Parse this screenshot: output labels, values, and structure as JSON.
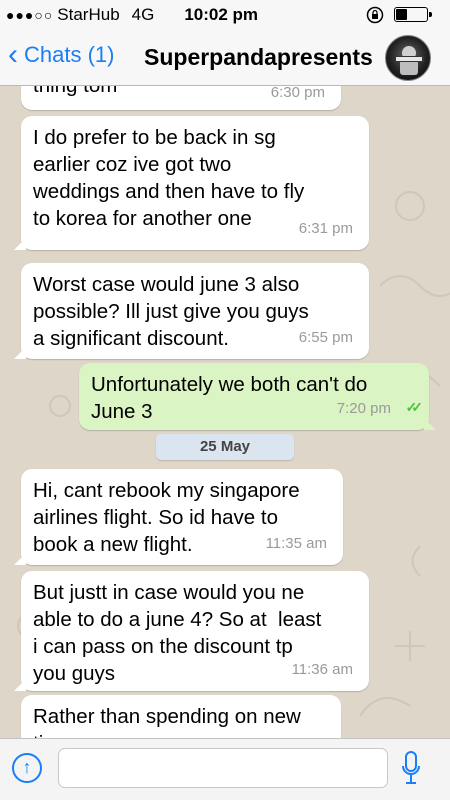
{
  "status": {
    "signal": "●●●○○",
    "carrier": "StarHub",
    "network": "4G",
    "time": "10:02 pm",
    "battery_level": 0.35
  },
  "nav": {
    "back_chevron": "‹",
    "back_label": "Chats (1)",
    "title": "Superpandapresents",
    "accent_color": "#1a7ef7"
  },
  "messages": [
    {
      "direction": "in",
      "text": "thing tom",
      "time": "6:30 pm"
    },
    {
      "direction": "in",
      "text": "I do prefer to be back in sg\nearlier coz ive got two\nweddings and then have to fly\nto korea for another one",
      "time": "6:31 pm"
    },
    {
      "direction": "in",
      "text": "Worst case would june 3 also\npossible? Ill just give you guys\na significant discount.",
      "time": "6:55 pm"
    },
    {
      "direction": "out",
      "text": "Unfortunately we both can't do\nJune 3",
      "time": "7:20 pm",
      "read_ticks": "✓✓"
    },
    {
      "direction": "in",
      "text": "Hi, cant rebook my singapore\nairlines flight. So id have to\nbook a new flight.",
      "time": "11:35 am"
    },
    {
      "direction": "in",
      "text": "But justt in case would you ne\nable to do a june 4? So at  least\ni can pass on the discount tp\nyou guys",
      "time": "11:36 am"
    },
    {
      "direction": "in",
      "text": "Rather than spending on new\ntix",
      "time": ""
    }
  ],
  "date_separator": "25 May",
  "input": {
    "upload_icon": "↑",
    "placeholder": "",
    "value": ""
  },
  "colors": {
    "incoming_bubble": "#ffffff",
    "outgoing_bubble": "#dbf4c4",
    "read_tick": "#4ec23c"
  }
}
